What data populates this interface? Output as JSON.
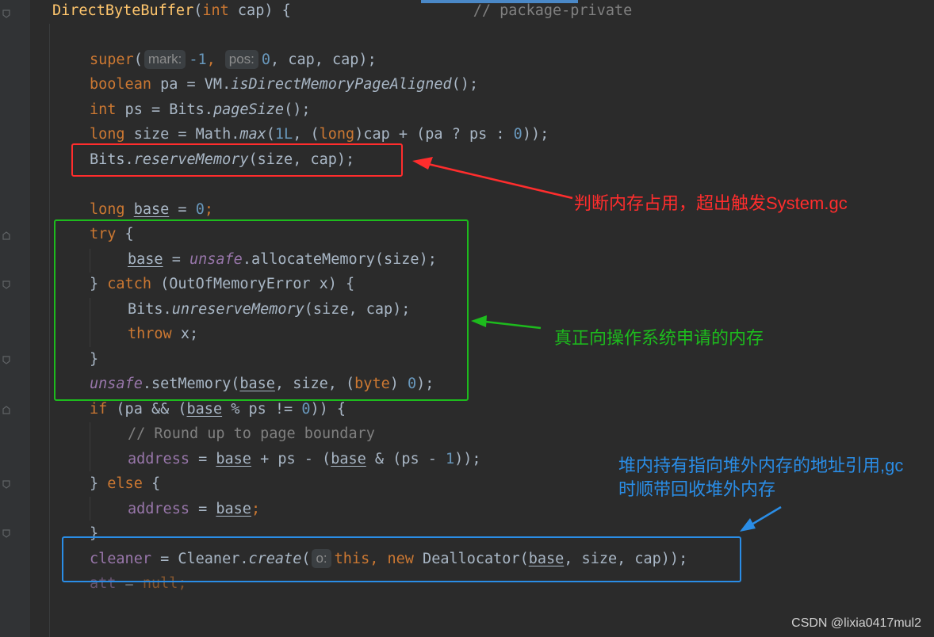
{
  "code": {
    "signature": {
      "name": "DirectByteBuffer",
      "open": "(",
      "kw": "int",
      "rest": " cap) {",
      "comment": "// package-private"
    },
    "l_super": {
      "fn": "super",
      "open": "(",
      "hint1": "mark:",
      "v1": "-1",
      "c1": ",",
      "hint2": "pos:",
      "v2": "0",
      "rest": ", cap, cap);"
    },
    "l_pa": {
      "kw": "boolean",
      "a": " pa = VM.",
      "call": "isDirectMemoryPageAligned",
      "b": "();"
    },
    "l_ps": {
      "kw": "int",
      "a": " ps = Bits.",
      "call": "pageSize",
      "b": "();"
    },
    "l_size": {
      "kw": "long",
      "a": " size = Math.",
      "call": "max",
      "b": "(",
      "n1": "1L",
      "c": ", (",
      "kw2": "long",
      "d": ")cap + (pa ? ps : ",
      "n2": "0",
      "e": "));"
    },
    "l_reserve": {
      "a": "Bits.",
      "call": "reserveMemory",
      "b": "(size, cap);"
    },
    "l_base": {
      "kw": "long",
      "sp": " ",
      "var": "base",
      "a": " = ",
      "n": "0",
      "b": ";"
    },
    "l_try": {
      "kw": "try",
      "a": " {"
    },
    "l_alloc": {
      "var": "base",
      "a": " = ",
      "fld": "unsafe",
      "b": ".allocateMemory(size);"
    },
    "l_catch": {
      "a": "} ",
      "kw": "catch",
      "b": " (OutOfMemoryError x) {"
    },
    "l_unreserve": {
      "a": "Bits.",
      "call": "unreserveMemory",
      "b": "(size, cap);"
    },
    "l_throw": {
      "kw": "throw",
      "a": " x;"
    },
    "l_close1": {
      "a": "}"
    },
    "l_setmem": {
      "fld": "unsafe",
      "a": ".setMemory(",
      "var": "base",
      "b": ", size, (",
      "kw": "byte",
      "c": ") ",
      "n": "0",
      "d": ");"
    },
    "l_if": {
      "kw": "if",
      "a": " (pa && (",
      "var": "base",
      "b": " % ps != ",
      "n": "0",
      "c": ")) {"
    },
    "l_comment": {
      "text": "// Round up to page boundary"
    },
    "l_addr1": {
      "fld": "address",
      "a": " = ",
      "var1": "base",
      "b": " + ps - (",
      "var2": "base",
      "c": " & (ps - ",
      "n": "1",
      "d": "));"
    },
    "l_else": {
      "a": "} ",
      "kw": "else",
      "b": " {"
    },
    "l_addr2": {
      "fld": "address",
      "a": " = ",
      "var": "base",
      "b": ";"
    },
    "l_close2": {
      "a": "}"
    },
    "l_cleaner": {
      "fld": "cleaner",
      "a": " = Cleaner.",
      "call": "create",
      "b": "(",
      "hint": "o:",
      "kw1": "this",
      "c": ", ",
      "kw2": "new",
      "d": " Deallocator(",
      "var": "base",
      "e": ", size, cap));"
    },
    "l_att": {
      "fld": "att",
      "a": " = ",
      "kw": "null",
      "b": ";"
    }
  },
  "annotations": {
    "red": "判断内存占用，超出触发System.gc",
    "green": "真正向操作系统申请的内存",
    "blue_line1": "堆内持有指向堆外内存的地址引用,gc",
    "blue_line2": "时顺带回收堆外内存"
  },
  "colors": {
    "red": "#ff2d2d",
    "green": "#1dbb1d",
    "blue": "#2a8de6"
  },
  "watermark": "CSDN @lixia0417mul2"
}
